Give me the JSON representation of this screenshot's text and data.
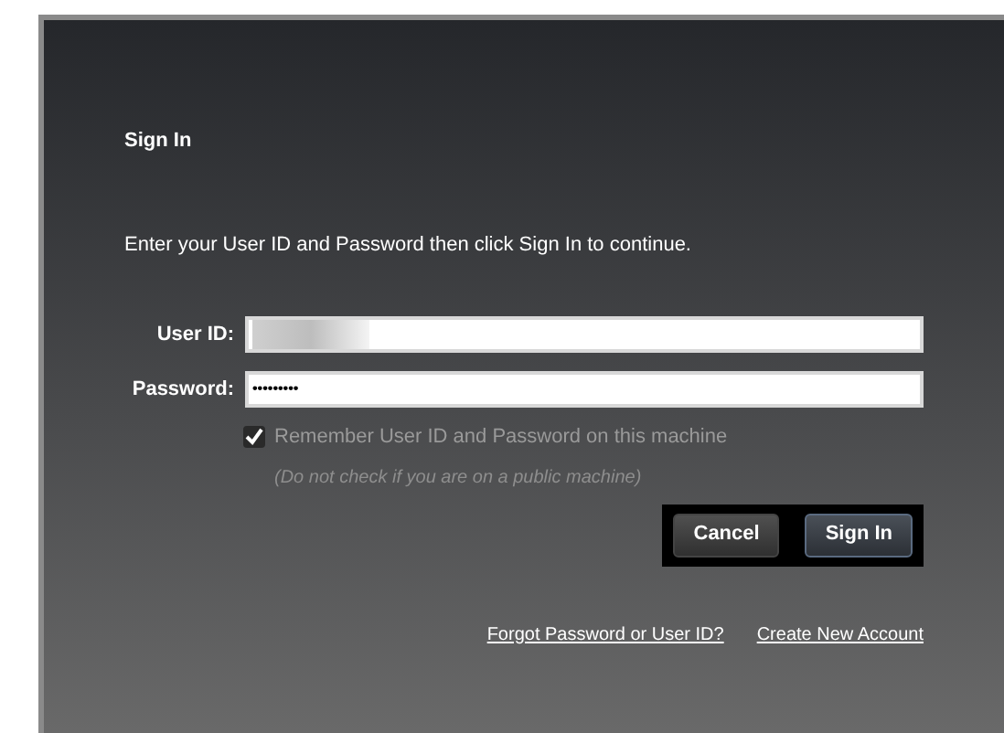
{
  "title": "Sign In",
  "instruction": "Enter your User ID and Password then click Sign In to continue.",
  "fields": [
    {
      "kind": "redacted",
      "label": "User ID:"
    },
    {
      "kind": "password",
      "label": "Password:",
      "value": "•••••••••"
    }
  ],
  "remember": {
    "label": "Remember User ID and Password on this machine",
    "checked": true,
    "note": "(Do not check if you are on a public machine)"
  },
  "buttons": [
    {
      "label": "Cancel",
      "primary": false
    },
    {
      "label": "Sign In",
      "primary": true
    }
  ],
  "links": [
    "Forgot Password or User ID?",
    "Create New Account"
  ]
}
